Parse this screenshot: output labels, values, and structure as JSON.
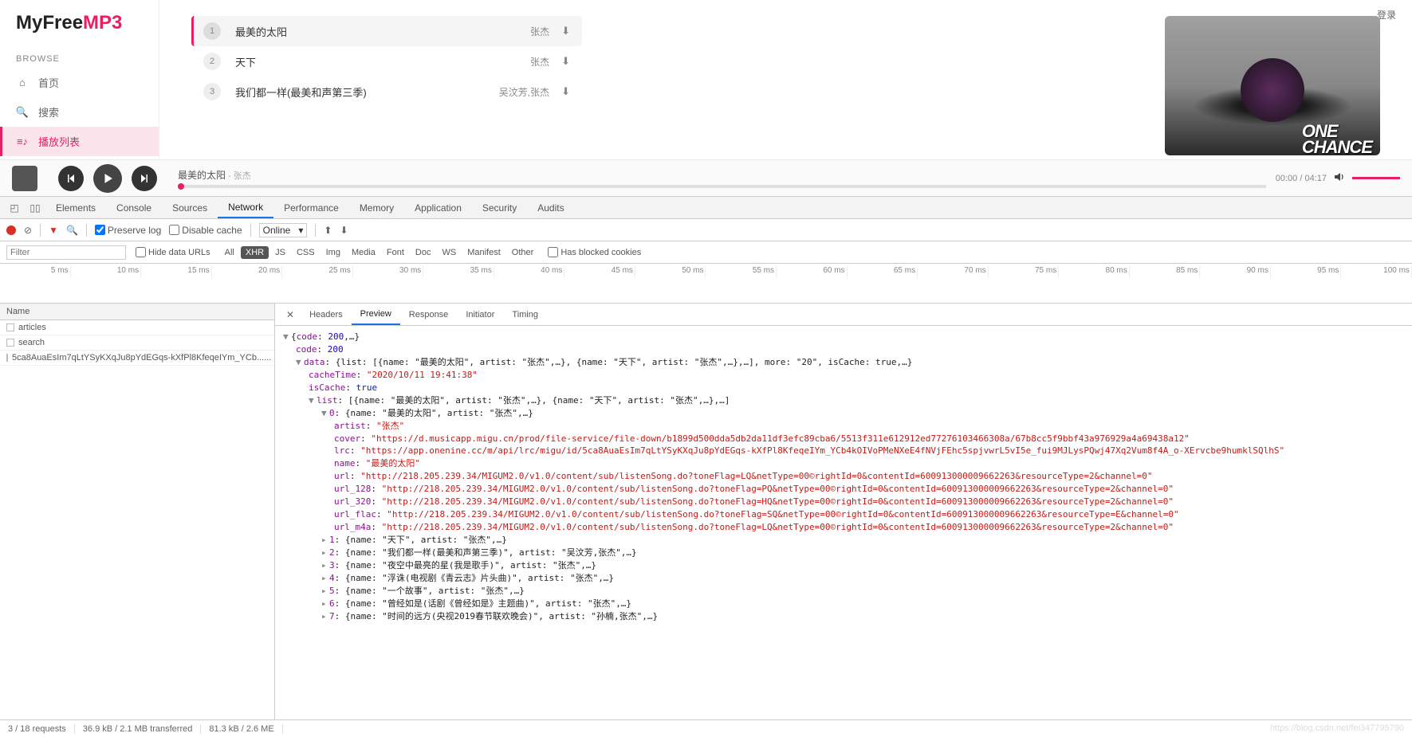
{
  "logo": {
    "left": "MyFree",
    "right": "MP3"
  },
  "topright": {
    "login": "登录"
  },
  "sidebar": {
    "browseLabel": "BROWSE",
    "items": [
      {
        "icon": "home-icon",
        "label": "首页",
        "active": false
      },
      {
        "icon": "search-icon",
        "label": "搜索",
        "active": false
      },
      {
        "icon": "playlist-icon",
        "label": "播放列表",
        "active": true
      }
    ]
  },
  "songs": [
    {
      "num": "1",
      "title": "最美的太阳",
      "artist": "张杰",
      "active": true
    },
    {
      "num": "2",
      "title": "天下",
      "artist": "张杰",
      "active": false
    },
    {
      "num": "3",
      "title": "我们都一样(最美和声第三季)",
      "artist": "吴汶芳,张杰",
      "active": false
    }
  ],
  "albumArt": {
    "title": "ONE\nCHANCE"
  },
  "player": {
    "title": "最美的太阳",
    "artist": " - 张杰",
    "currentTime": "00:00",
    "duration": "04:17",
    "sep": " / "
  },
  "devtools": {
    "tabs": [
      "Elements",
      "Console",
      "Sources",
      "Network",
      "Performance",
      "Memory",
      "Application",
      "Security",
      "Audits"
    ],
    "activeTab": "Network",
    "preserveLog": "Preserve log",
    "disableCache": "Disable cache",
    "online": "Online",
    "filterPlaceholder": "Filter",
    "hideDataUrls": "Hide data URLs",
    "filters": [
      "All",
      "XHR",
      "JS",
      "CSS",
      "Img",
      "Media",
      "Font",
      "Doc",
      "WS",
      "Manifest",
      "Other"
    ],
    "activeFilter": "XHR",
    "hasBlocked": "Has blocked cookies",
    "ticks": [
      "5 ms",
      "10 ms",
      "15 ms",
      "20 ms",
      "25 ms",
      "30 ms",
      "35 ms",
      "40 ms",
      "45 ms",
      "50 ms",
      "55 ms",
      "60 ms",
      "65 ms",
      "70 ms",
      "75 ms",
      "80 ms",
      "85 ms",
      "90 ms",
      "95 ms",
      "100 ms"
    ],
    "reqHeader": "Name",
    "requests": [
      "articles",
      "search",
      "5ca8AuaEsIm7qLtYSyKXqJu8pYdEGqs-kXfPl8KfeqeIYm_YCb......"
    ],
    "detailTabs": [
      "Headers",
      "Preview",
      "Response",
      "Initiator",
      "Timing"
    ],
    "detailActive": "Preview",
    "json": {
      "codeLabel": "code",
      "codeVal": "200",
      "dataSummary": "{list: [{name: \"最美的太阳\", artist: \"张杰\",…}, {name: \"天下\", artist: \"张杰\",…},…], more: \"20\", isCache: true,…}",
      "cacheTimeKey": "cacheTime",
      "cacheTimeVal": "\"2020/10/11 19:41:38\"",
      "isCacheKey": "isCache",
      "isCacheVal": "true",
      "listSummary": "[{name: \"最美的太阳\", artist: \"张杰\",…}, {name: \"天下\", artist: \"张杰\",…},…]",
      "item0Summary": "{name: \"最美的太阳\", artist: \"张杰\",…}",
      "fields": [
        {
          "k": "artist",
          "v": "\"张杰\""
        },
        {
          "k": "cover",
          "v": "\"https://d.musicapp.migu.cn/prod/file-service/file-down/b1899d500dda5db2da11df3efc89cba6/5513f311e612912ed77276103466308a/67b8cc5f9bbf43a976929a4a69438a12\""
        },
        {
          "k": "lrc",
          "v": "\"https://app.onenine.cc/m/api/lrc/migu/id/5ca8AuaEsIm7qLtYSyKXqJu8pYdEGqs-kXfPl8KfeqeIYm_YCb4kOIVoPMeNXeE4fNVjFEhc5spjvwrL5vI5e_fui9MJLysPQwj47Xq2Vum8f4A_o-XErvcbe9humklSQlhS\""
        },
        {
          "k": "name",
          "v": "\"最美的太阳\""
        },
        {
          "k": "url",
          "v": "\"http://218.205.239.34/MIGUM2.0/v1.0/content/sub/listenSong.do?toneFlag=LQ&netType=00&copyrightId=0&contentId=600913000009662263&resourceType=2&channel=0\""
        },
        {
          "k": "url_128",
          "v": "\"http://218.205.239.34/MIGUM2.0/v1.0/content/sub/listenSong.do?toneFlag=PQ&netType=00&copyrightId=0&contentId=600913000009662263&resourceType=2&channel=0\""
        },
        {
          "k": "url_320",
          "v": "\"http://218.205.239.34/MIGUM2.0/v1.0/content/sub/listenSong.do?toneFlag=HQ&netType=00&copyrightId=0&contentId=600913000009662263&resourceType=2&channel=0\""
        },
        {
          "k": "url_flac",
          "v": "\"http://218.205.239.34/MIGUM2.0/v1.0/content/sub/listenSong.do?toneFlag=SQ&netType=00&copyrightId=0&contentId=600913000009662263&resourceType=E&channel=0\""
        },
        {
          "k": "url_m4a",
          "v": "\"http://218.205.239.34/MIGUM2.0/v1.0/content/sub/listenSong.do?toneFlag=LQ&netType=00&copyrightId=0&contentId=600913000009662263&resourceType=2&channel=0\""
        }
      ],
      "rest": [
        {
          "i": "1",
          "s": "{name: \"天下\", artist: \"张杰\",…}"
        },
        {
          "i": "2",
          "s": "{name: \"我们都一样(最美和声第三季)\", artist: \"吴汶芳,张杰\",…}"
        },
        {
          "i": "3",
          "s": "{name: \"夜空中最亮的星(我是歌手)\", artist: \"张杰\",…}"
        },
        {
          "i": "4",
          "s": "{name: \"浮诛(电视剧《青云志》片头曲)\", artist: \"张杰\",…}"
        },
        {
          "i": "5",
          "s": "{name: \"一个故事\", artist: \"张杰\",…}"
        },
        {
          "i": "6",
          "s": "{name: \"曾经如是(话剧《曾经如是》主题曲)\", artist: \"张杰\",…}"
        },
        {
          "i": "7",
          "s": "{name: \"时间的远方(央视2019春节联欢晚会)\", artist: \"孙楠,张杰\",…}"
        }
      ]
    },
    "status": {
      "requests": "3 / 18 requests",
      "transferred": "36.9 kB / 2.1 MB transferred",
      "resources": "81.3 kB / 2.6 ME"
    }
  },
  "watermark": "https://blog.csdn.net/fei347795790"
}
